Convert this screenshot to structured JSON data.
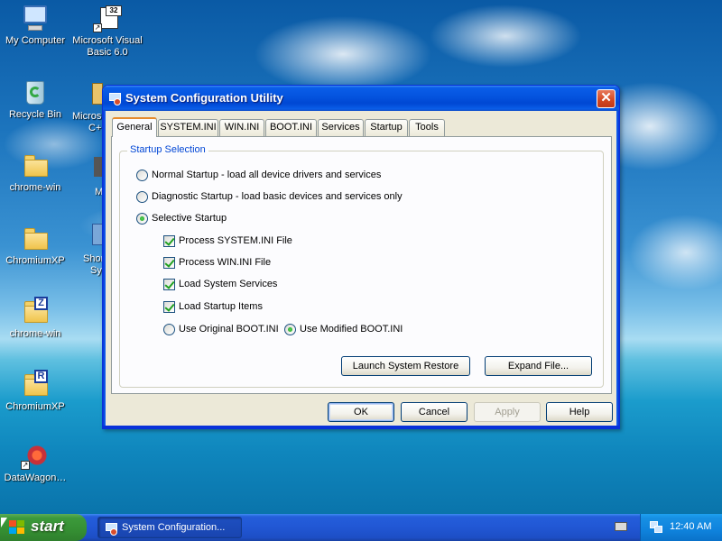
{
  "desktop": {
    "icons": [
      {
        "label": "My Computer",
        "icon": "my-computer-icon"
      },
      {
        "label": "Microsoft Visual Basic 6.0",
        "icon": "visual-basic-icon"
      },
      {
        "label": "Recycle Bin",
        "icon": "recycle-bin-icon"
      },
      {
        "label": "chrome-win",
        "icon": "folder-icon"
      },
      {
        "label": "ChromiumXP",
        "icon": "folder-icon"
      },
      {
        "label": "chrome-win",
        "icon": "folder-z-icon",
        "badge": "Z"
      },
      {
        "label": "ChromiumXP",
        "icon": "folder-r-icon",
        "badge": "R"
      },
      {
        "label": "DataWagon…",
        "icon": "datawagon-icon"
      }
    ],
    "partial_icons": [
      "Micros",
      "C+",
      "M",
      "Shor",
      "Sy"
    ]
  },
  "window": {
    "title": "System Configuration Utility",
    "close_label": "✕",
    "tabs": [
      {
        "label": "General",
        "active": true
      },
      {
        "label": "SYSTEM.INI"
      },
      {
        "label": "WIN.INI"
      },
      {
        "label": "BOOT.INI"
      },
      {
        "label": "Services"
      },
      {
        "label": "Startup"
      },
      {
        "label": "Tools"
      }
    ],
    "group_label": "Startup Selection",
    "radios": [
      {
        "label": "Normal Startup - load all device drivers and services",
        "checked": false
      },
      {
        "label": "Diagnostic Startup - load basic devices and services only",
        "checked": false
      },
      {
        "label": "Selective Startup",
        "checked": true
      }
    ],
    "checkboxes": [
      {
        "label": "Process SYSTEM.INI File",
        "checked": true
      },
      {
        "label": "Process WIN.INI File",
        "checked": true
      },
      {
        "label": "Load System Services",
        "checked": true
      },
      {
        "label": "Load Startup Items",
        "checked": true
      }
    ],
    "boot_radios": [
      {
        "label": "Use Original BOOT.INI",
        "checked": false
      },
      {
        "label": "Use Modified BOOT.INI",
        "checked": true
      }
    ],
    "buttons": {
      "restore": "Launch System Restore",
      "expand": "Expand File...",
      "ok": "OK",
      "cancel": "Cancel",
      "apply": "Apply",
      "help": "Help"
    }
  },
  "taskbar": {
    "start_label": "start",
    "task_item": "System Configuration...",
    "clock": "12:40 AM"
  },
  "colors": {
    "title_bar": "#0453de",
    "group_label": "#0046d5",
    "start_green": "#358f33",
    "tray_blue": "#0f83dd"
  }
}
